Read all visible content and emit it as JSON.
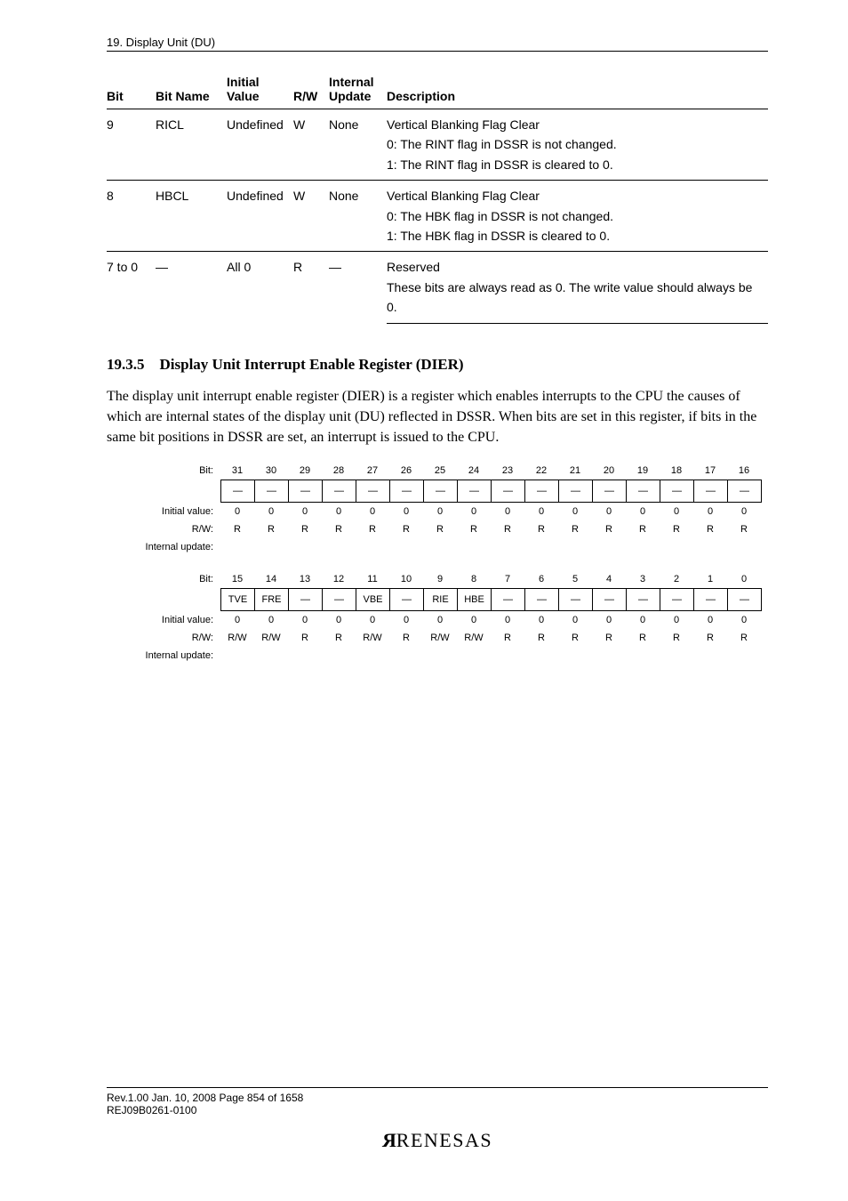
{
  "section_header": "19.   Display Unit (DU)",
  "table_headers": {
    "bit": "Bit",
    "bit_name": "Bit Name",
    "initial_value": "Initial\nValue",
    "rw": "R/W",
    "internal_update": "Internal\nUpdate",
    "description": "Description"
  },
  "rows": [
    {
      "bit": "9",
      "bit_name": "RICL",
      "initial": "Undefined",
      "rw": "W",
      "update": "None",
      "desc": [
        "Vertical Blanking Flag Clear",
        "0: The RINT flag in DSSR is not changed.",
        "1: The RINT flag in DSSR is cleared to 0."
      ]
    },
    {
      "bit": "8",
      "bit_name": "HBCL",
      "initial": "Undefined",
      "rw": "W",
      "update": "None",
      "desc": [
        "Vertical Blanking Flag Clear",
        "0: The HBK flag in DSSR is not changed.",
        "1: The HBK flag in DSSR is cleared to 0."
      ]
    },
    {
      "bit": "7 to 0",
      "bit_name": "—",
      "initial": "All 0",
      "rw": "R",
      "update": "—",
      "desc": [
        "Reserved",
        "These bits are always read as 0. The write value should always be 0."
      ]
    }
  ],
  "subheading_no": "19.3.5",
  "subheading_title": "Display Unit Interrupt Enable Register (DIER)",
  "body_text": "The display unit interrupt enable register (DIER) is a register which enables interrupts to the CPU the causes of which are internal states of the display unit (DU) reflected in DSSR. When bits are set in this register, if bits in the same bit positions in DSSR are set, an interrupt is issued to the CPU.",
  "reg_labels": {
    "bit": "Bit:",
    "initial": "Initial value:",
    "rw": "R/W:",
    "update": "Internal update:"
  },
  "upper_bits": [
    "31",
    "30",
    "29",
    "28",
    "27",
    "26",
    "25",
    "24",
    "23",
    "22",
    "21",
    "20",
    "19",
    "18",
    "17",
    "16"
  ],
  "upper_names": [
    "—",
    "—",
    "—",
    "—",
    "—",
    "—",
    "—",
    "—",
    "—",
    "—",
    "—",
    "—",
    "—",
    "—",
    "—",
    "—"
  ],
  "upper_iv": [
    "0",
    "0",
    "0",
    "0",
    "0",
    "0",
    "0",
    "0",
    "0",
    "0",
    "0",
    "0",
    "0",
    "0",
    "0",
    "0"
  ],
  "upper_rw": [
    "R",
    "R",
    "R",
    "R",
    "R",
    "R",
    "R",
    "R",
    "R",
    "R",
    "R",
    "R",
    "R",
    "R",
    "R",
    "R"
  ],
  "lower_bits": [
    "15",
    "14",
    "13",
    "12",
    "11",
    "10",
    "9",
    "8",
    "7",
    "6",
    "5",
    "4",
    "3",
    "2",
    "1",
    "0"
  ],
  "lower_names": [
    "TVE",
    "FRE",
    "—",
    "—",
    "VBE",
    "—",
    "RIE",
    "HBE",
    "—",
    "—",
    "—",
    "—",
    "—",
    "—",
    "—",
    "—"
  ],
  "lower_iv": [
    "0",
    "0",
    "0",
    "0",
    "0",
    "0",
    "0",
    "0",
    "0",
    "0",
    "0",
    "0",
    "0",
    "0",
    "0",
    "0"
  ],
  "lower_rw": [
    "R/W",
    "R/W",
    "R",
    "R",
    "R/W",
    "R",
    "R/W",
    "R/W",
    "R",
    "R",
    "R",
    "R",
    "R",
    "R",
    "R",
    "R"
  ],
  "footer_line1": "Rev.1.00  Jan. 10, 2008  Page 854 of 1658",
  "footer_line2": "REJ09B0261-0100",
  "logo_text": "RENESAS"
}
